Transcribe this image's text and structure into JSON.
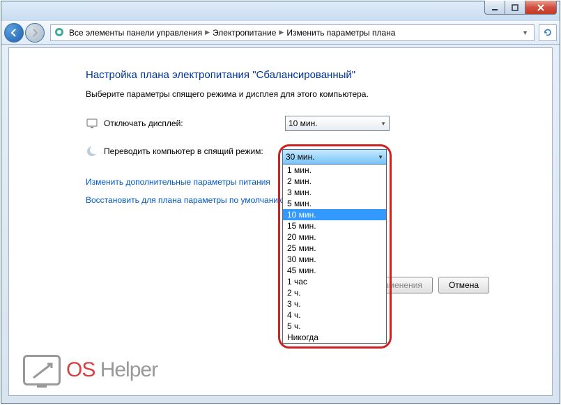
{
  "breadcrumb": {
    "root": "Все элементы панели управления",
    "mid": "Электропитание",
    "leaf": "Изменить параметры плана"
  },
  "page": {
    "title": "Настройка плана электропитания \"Сбалансированный\"",
    "subtitle": "Выберите параметры спящего режима и дисплея для этого компьютера."
  },
  "settings": {
    "display_off_label": "Отключать дисплей:",
    "display_off_value": "10 мин.",
    "sleep_label": "Переводить компьютер в спящий режим:",
    "sleep_value": "30 мин."
  },
  "links": {
    "advanced": "Изменить дополнительные параметры питания",
    "restore": "Восстановить для плана параметры по умолчанию"
  },
  "buttons": {
    "save": "Сохранить изменения",
    "cancel": "Отмена"
  },
  "dropdown_options": [
    "1 мин.",
    "2 мин.",
    "3 мин.",
    "5 мин.",
    "10 мин.",
    "15 мин.",
    "20 мин.",
    "25 мин.",
    "30 мин.",
    "45 мин.",
    "1 час",
    "2 ч.",
    "3 ч.",
    "4 ч.",
    "5 ч.",
    "Никогда"
  ],
  "dropdown_highlighted": "10 мин.",
  "watermark": {
    "os": "OS",
    "text": " Helper"
  }
}
